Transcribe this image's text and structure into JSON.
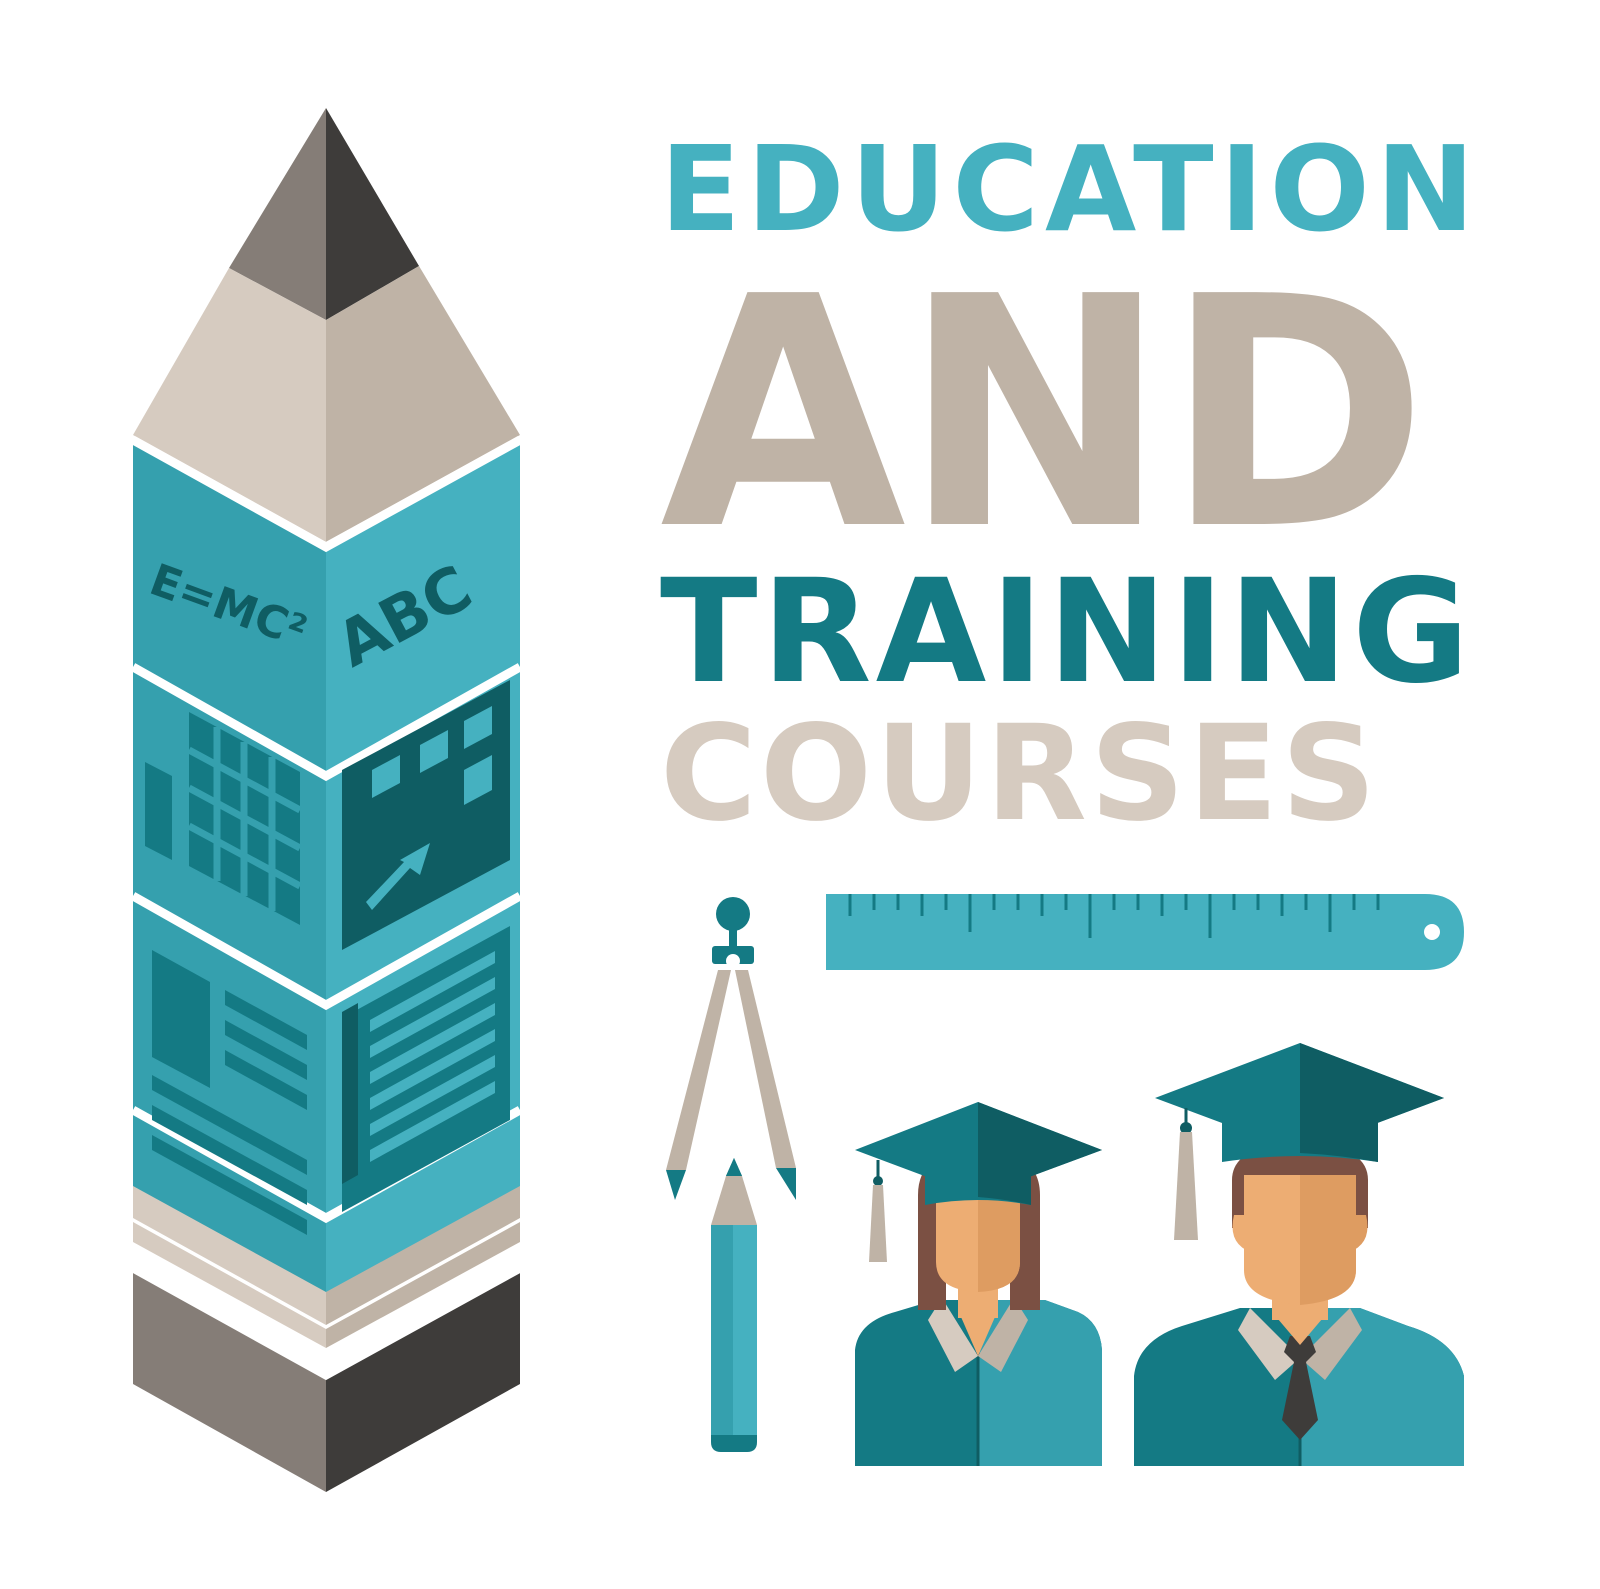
{
  "headline": {
    "line1": "EDUCATION",
    "line2": "AND",
    "line3": "TRAINING",
    "line4": "COURSES"
  },
  "pencil_tower": {
    "formula_text": "E=MC²",
    "letters_text": "ABC"
  },
  "icons": {
    "tower": "pencil-tower-icon",
    "compass": "drawing-compass-icon",
    "ruler": "ruler-icon",
    "pencil": "pencil-icon",
    "graduate_female": "female-graduate-icon",
    "graduate_male": "male-graduate-icon"
  },
  "colors": {
    "teal_light": "#45b1c0",
    "teal_mid": "#35a0ae",
    "teal_dark": "#147a84",
    "teal_darker": "#0f5d63",
    "beige": "#bfb3a6",
    "beige_light": "#d6cbc0",
    "gray_dark": "#3e3c3a",
    "gray_mid": "#857d77",
    "skin": "#edad73",
    "skin_shade": "#de9c61",
    "hair": "#7b5043"
  }
}
